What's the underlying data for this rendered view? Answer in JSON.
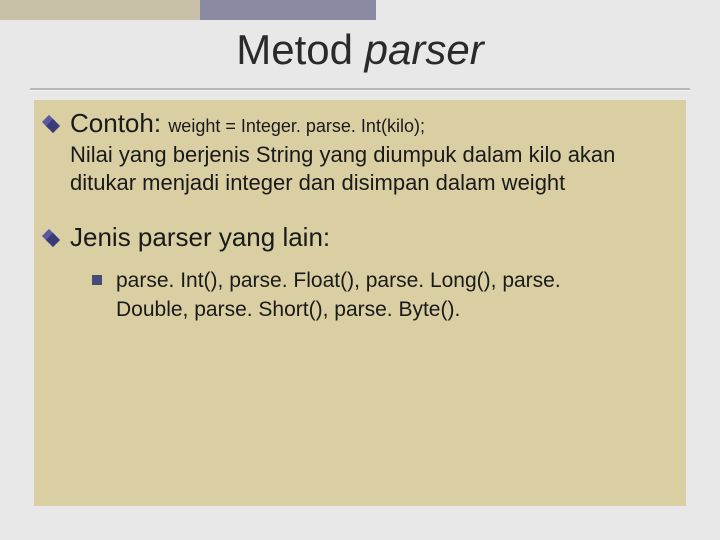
{
  "title": {
    "word1": "Metod ",
    "word2": "parser"
  },
  "section1": {
    "label": "Contoh:",
    "code": "weight = Integer. parse. Int(kilo);",
    "body": "Nilai yang berjenis String yang diumpuk dalam kilo akan ditukar menjadi integer dan disimpan dalam weight"
  },
  "section2": {
    "heading": "Jenis parser yang lain:",
    "sub": "parse. Int(), parse. Float(), parse. Long(), parse. Double, parse. Short(), parse. Byte()."
  }
}
